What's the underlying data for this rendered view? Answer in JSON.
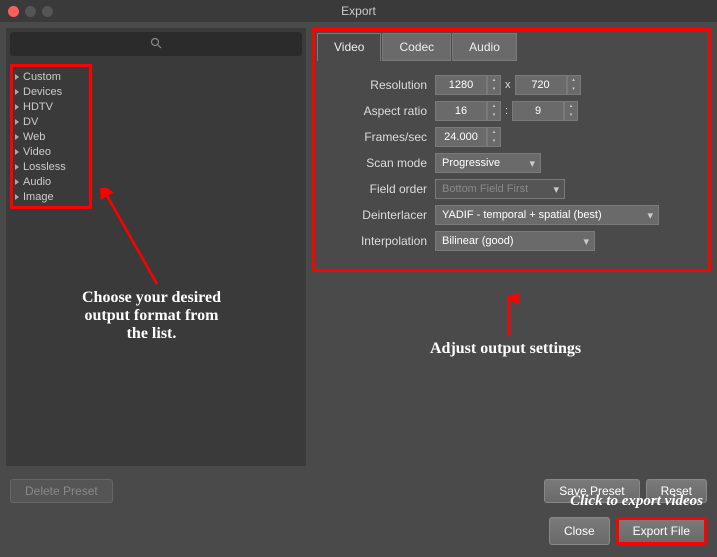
{
  "window": {
    "title": "Export"
  },
  "sidebar": {
    "items": [
      "Custom",
      "Devices",
      "HDTV",
      "DV",
      "Web",
      "Video",
      "Lossless",
      "Audio",
      "Image"
    ]
  },
  "tabs": [
    "Video",
    "Codec",
    "Audio"
  ],
  "form": {
    "resolution": {
      "label": "Resolution",
      "w": "1280",
      "h": "720",
      "sep": "x"
    },
    "aspect": {
      "label": "Aspect ratio",
      "w": "16",
      "h": "9",
      "sep": ":"
    },
    "fps": {
      "label": "Frames/sec",
      "value": "24.000"
    },
    "scanmode": {
      "label": "Scan mode",
      "value": "Progressive"
    },
    "fieldorder": {
      "label": "Field order",
      "value": "Bottom Field First"
    },
    "deinterlacer": {
      "label": "Deinterlacer",
      "value": "YADIF - temporal + spatial (best)"
    },
    "interpolation": {
      "label": "Interpolation",
      "value": "Bilinear (good)"
    }
  },
  "buttons": {
    "delete_preset": "Delete Preset",
    "save_preset": "Save Preset",
    "reset": "Reset",
    "close": "Close",
    "export_file": "Export File"
  },
  "annotations": {
    "choose_format": "Choose your desired\noutput format from\nthe list.",
    "adjust_settings": "Adjust output settings",
    "click_export": "Click to export videos"
  }
}
